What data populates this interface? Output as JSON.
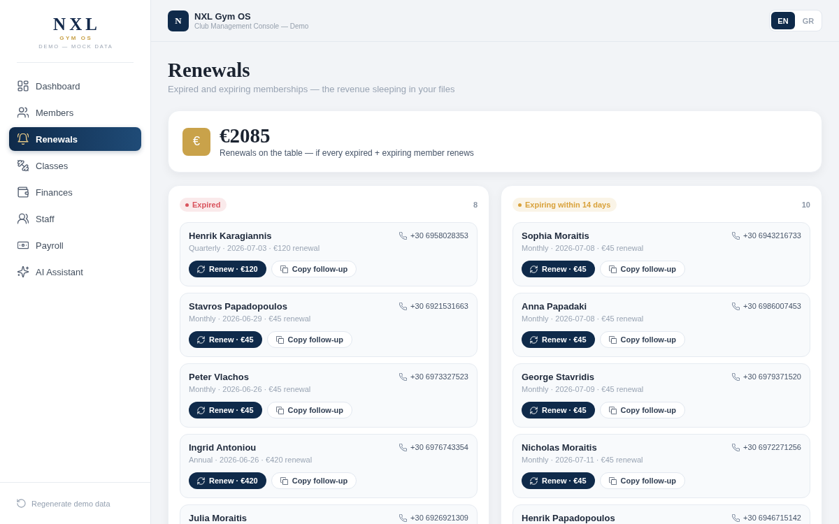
{
  "sidebar": {
    "logo": {
      "wordmark": "NXL",
      "product": "GYM OS",
      "tagline": "DEMO — MOCK DATA"
    },
    "nav": [
      {
        "label": "Dashboard",
        "selected": false
      },
      {
        "label": "Members",
        "selected": false
      },
      {
        "label": "Renewals",
        "selected": true
      },
      {
        "label": "Classes",
        "selected": false
      },
      {
        "label": "Finances",
        "selected": false
      },
      {
        "label": "Staff",
        "selected": false
      },
      {
        "label": "Payroll",
        "selected": false
      },
      {
        "label": "AI Assistant",
        "selected": false
      }
    ],
    "footer_action": "Regenerate demo data"
  },
  "header": {
    "badge": "N",
    "title": "NXL Gym OS",
    "subtitle": "Club Management Console — Demo",
    "languages": [
      {
        "label": "EN",
        "selected": true
      },
      {
        "label": "GR",
        "selected": false
      }
    ]
  },
  "page": {
    "title": "Renewals",
    "subtitle": "Expired and expiring memberships — the revenue sleeping in your files"
  },
  "summary": {
    "symbol": "€",
    "amount": "€2085",
    "caption": "Renewals on the table — if every expired + expiring member renews"
  },
  "columns": [
    {
      "status": "Expired",
      "color": "#d9545e",
      "count": "8",
      "members": [
        {
          "name": "Henrik Karagiannis",
          "meta": "Quarterly · 2026-07-03 · €120 renewal",
          "phone": "+30 6958028353",
          "renew": "Renew · €120",
          "follow_up": "Copy follow-up"
        },
        {
          "name": "Stavros Papadopoulos",
          "meta": "Monthly · 2026-06-29 · €45 renewal",
          "phone": "+30 6921531663",
          "renew": "Renew · €45",
          "follow_up": "Copy follow-up"
        },
        {
          "name": "Peter Vlachos",
          "meta": "Monthly · 2026-06-26 · €45 renewal",
          "phone": "+30 6973327523",
          "renew": "Renew · €45",
          "follow_up": "Copy follow-up"
        },
        {
          "name": "Ingrid Antoniou",
          "meta": "Annual · 2026-06-26 · €420 renewal",
          "phone": "+30 6976743354",
          "renew": "Renew · €420",
          "follow_up": "Copy follow-up"
        },
        {
          "name": "Julia Moraitis",
          "phone": "+30 6926921309"
        }
      ]
    },
    {
      "status": "Expiring within 14 days",
      "color": "#d9a23c",
      "count": "10",
      "members": [
        {
          "name": "Sophia Moraitis",
          "meta": "Monthly · 2026-07-08 · €45 renewal",
          "phone": "+30 6943216733",
          "renew": "Renew · €45",
          "follow_up": "Copy follow-up"
        },
        {
          "name": "Anna Papadaki",
          "meta": "Monthly · 2026-07-08 · €45 renewal",
          "phone": "+30 6986007453",
          "renew": "Renew · €45",
          "follow_up": "Copy follow-up"
        },
        {
          "name": "George Stavridis",
          "meta": "Monthly · 2026-07-09 · €45 renewal",
          "phone": "+30 6979371520",
          "renew": "Renew · €45",
          "follow_up": "Copy follow-up"
        },
        {
          "name": "Nicholas Moraitis",
          "meta": "Monthly · 2026-07-11 · €45 renewal",
          "phone": "+30 6972271256",
          "renew": "Renew · €45",
          "follow_up": "Copy follow-up"
        },
        {
          "name": "Henrik Papadopoulos",
          "phone": "+30 6946715142"
        }
      ]
    }
  ]
}
